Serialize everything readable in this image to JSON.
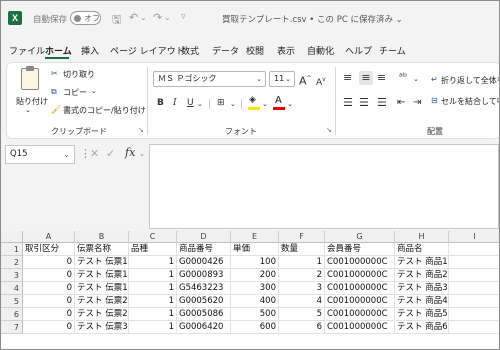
{
  "titlebar": {
    "app_icon": "X",
    "autosave_label": "自動保存",
    "autosave_state": "オフ",
    "title": "買取テンプレート.csv • この PC に保存済み",
    "title_chevron": "⌄"
  },
  "tabs": [
    {
      "label": "ファイル",
      "active": false
    },
    {
      "label": "ホーム",
      "active": true
    },
    {
      "label": "挿入",
      "active": false
    },
    {
      "label": "ページ レイアウト",
      "active": false
    },
    {
      "label": "数式",
      "active": false
    },
    {
      "label": "データ",
      "active": false
    },
    {
      "label": "校閲",
      "active": false
    },
    {
      "label": "表示",
      "active": false
    },
    {
      "label": "自動化",
      "active": false
    },
    {
      "label": "ヘルプ",
      "active": false
    },
    {
      "label": "チーム",
      "active": false
    }
  ],
  "ribbon": {
    "clipboard": {
      "paste_label": "貼り付け",
      "cut_label": "切り取り",
      "copy_label": "コピー",
      "format_painter_label": "書式のコピー/貼り付け",
      "group_label": "クリップボード"
    },
    "font": {
      "font_name": "ＭＳ Ｐゴシック",
      "font_size": "11",
      "group_label": "フォント"
    },
    "alignment": {
      "wrap_label": "折り返して全体を",
      "merge_label": "セルを結合して中",
      "group_label": "配置"
    }
  },
  "formula_bar": {
    "name_box": "Q15",
    "fx": "fx",
    "value": ""
  },
  "grid": {
    "columns": [
      "A",
      "B",
      "C",
      "D",
      "E",
      "F",
      "G",
      "H",
      "I"
    ],
    "row_numbers": [
      "1",
      "2",
      "3",
      "4",
      "5",
      "6",
      "7"
    ],
    "rows": [
      [
        "取引区分",
        "伝票名称",
        "品種",
        "商品番号",
        "単価",
        "数量",
        "会員番号",
        "商品名",
        ""
      ],
      [
        "0",
        "テスト 伝票1",
        "1",
        "G0000426",
        "100",
        "1",
        "C001000000C",
        "テスト 商品1",
        ""
      ],
      [
        "0",
        "テスト 伝票1",
        "1",
        "G0000893",
        "200",
        "2",
        "C001000000C",
        "テスト 商品2",
        ""
      ],
      [
        "0",
        "テスト 伝票1",
        "1",
        "G5463223",
        "300",
        "3",
        "C001000000C",
        "テスト 商品3",
        ""
      ],
      [
        "0",
        "テスト 伝票2",
        "1",
        "G0005620",
        "400",
        "4",
        "C001000000C",
        "テスト 商品4",
        ""
      ],
      [
        "0",
        "テスト 伝票2",
        "1",
        "G0005086",
        "500",
        "5",
        "C001000000C",
        "テスト 商品5",
        ""
      ],
      [
        "0",
        "テスト 伝票3",
        "1",
        "G0006420",
        "600",
        "6",
        "C001000000C",
        "テスト 商品6",
        ""
      ]
    ]
  }
}
